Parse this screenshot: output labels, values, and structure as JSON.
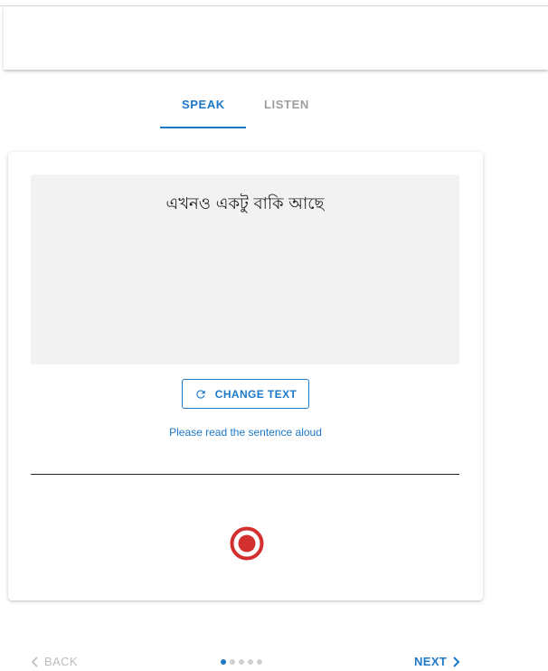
{
  "tabs": [
    {
      "label": "SPEAK",
      "active": true
    },
    {
      "label": "LISTEN",
      "active": false
    }
  ],
  "card": {
    "sentence": "এখনও একটু বাকি আছে",
    "change_text_label": "CHANGE TEXT",
    "hint": "Please read the sentence aloud"
  },
  "footer": {
    "back_label": "BACK",
    "next_label": "NEXT",
    "steps_total": 5,
    "current_step": 1
  },
  "colors": {
    "accent": "#1e78c8",
    "record": "#d32f2f",
    "disabled": "#bdbdbd"
  },
  "icons": {
    "change_text": "refresh-icon",
    "record": "record-icon",
    "back": "chevron-left-icon",
    "next": "chevron-right-icon"
  }
}
